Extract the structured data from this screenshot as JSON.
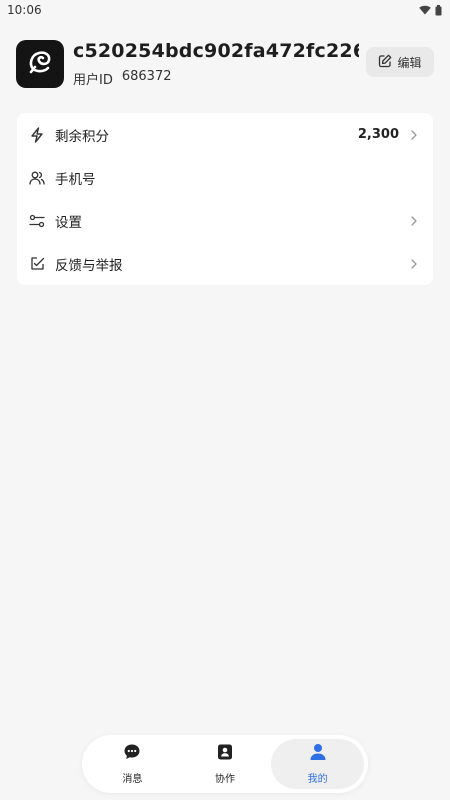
{
  "status_bar": {
    "time": "10:06"
  },
  "profile": {
    "name": "c520254bdc902fa472fc226…",
    "id_label": "用户ID",
    "id_value": "686372",
    "edit_label": "编辑"
  },
  "menu": {
    "items": [
      {
        "label": "剩余积分",
        "value": "2,300",
        "icon": "lightning-icon",
        "chevron": true
      },
      {
        "label": "手机号",
        "icon": "users-icon",
        "chevron": false
      },
      {
        "label": "设置",
        "icon": "sliders-icon",
        "chevron": true
      },
      {
        "label": "反馈与举报",
        "icon": "feedback-edit-icon",
        "chevron": true
      }
    ]
  },
  "tabs": [
    {
      "label": "消息",
      "icon": "chat-bubble-icon",
      "active": false
    },
    {
      "label": "协作",
      "icon": "contact-card-icon",
      "active": false
    },
    {
      "label": "我的",
      "icon": "person-icon",
      "active": true
    }
  ],
  "colors": {
    "accent": "#2f6fe6",
    "background": "#f6f6f6",
    "card": "#ffffff",
    "avatar_bg": "#141414"
  }
}
